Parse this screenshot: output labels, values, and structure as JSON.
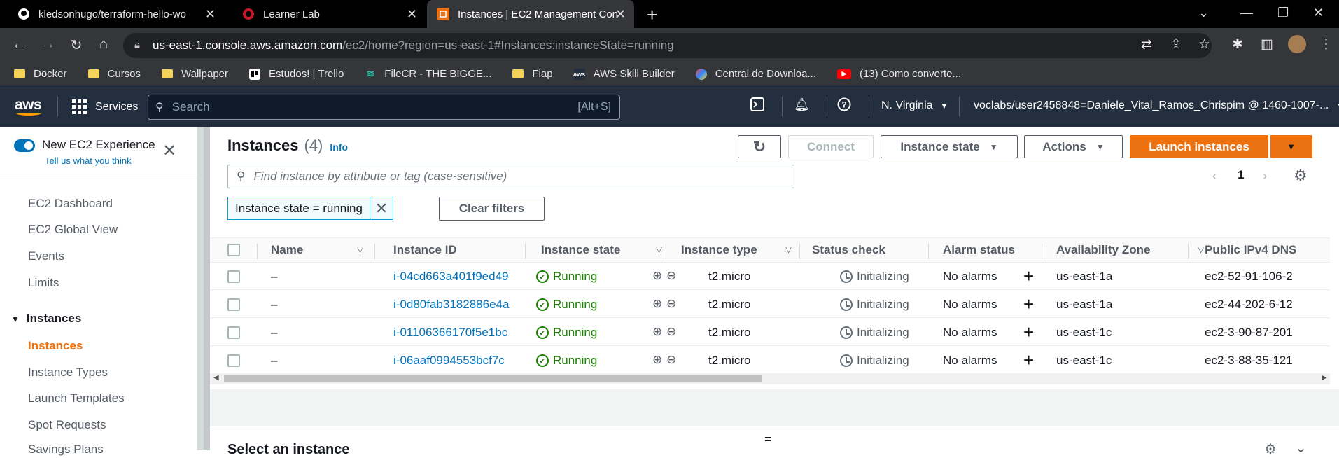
{
  "browser": {
    "tabs": [
      {
        "label": "kledsonhugo/terraform-hello-wo",
        "icon": "github-icon"
      },
      {
        "label": "Learner Lab",
        "icon": "learner-lab-icon"
      },
      {
        "label": "Instances | EC2 Management Con",
        "icon": "ec2-icon"
      }
    ],
    "url_host": "us-east-1.console.aws.amazon.com",
    "url_path": "/ec2/home?region=us-east-1#Instances:instanceState=running",
    "bookmarks": [
      {
        "label": "Docker",
        "icon": "folder-icon"
      },
      {
        "label": "Cursos",
        "icon": "folder-icon"
      },
      {
        "label": "Wallpaper",
        "icon": "folder-icon"
      },
      {
        "label": "Estudos! | Trello",
        "icon": "trello-icon"
      },
      {
        "label": "FileCR - THE BIGGE...",
        "icon": "filecr-icon"
      },
      {
        "label": "Fiap",
        "icon": "folder-icon"
      },
      {
        "label": "AWS Skill Builder",
        "icon": "aws-icon"
      },
      {
        "label": "Central de Downloa...",
        "icon": "central-icon"
      },
      {
        "label": "(13) Como converte...",
        "icon": "youtube-icon"
      }
    ]
  },
  "aws_nav": {
    "logo": "aws",
    "services": "Services",
    "search_placeholder": "Search",
    "search_shortcut": "[Alt+S]",
    "region": "N. Virginia",
    "account": "voclabs/user2458848=Daniele_Vital_Ramos_Chrispim @ 1460-1007-..."
  },
  "sidebar": {
    "new_experience": "New EC2 Experience",
    "tell_us": "Tell us what you think",
    "items_top": [
      "EC2 Dashboard",
      "EC2 Global View",
      "Events",
      "Limits"
    ],
    "section": "Instances",
    "items_section": [
      "Instances",
      "Instance Types",
      "Launch Templates",
      "Spot Requests",
      "Savings Plans"
    ],
    "active": "Instances"
  },
  "main": {
    "title": "Instances",
    "count": "(4)",
    "info": "Info",
    "connect": "Connect",
    "instance_state": "Instance state",
    "actions": "Actions",
    "launch": "Launch instances",
    "filter_placeholder": "Find instance by attribute or tag (case-sensitive)",
    "page": "1",
    "token": "Instance state = running",
    "clear_filters": "Clear filters",
    "columns": [
      "Name",
      "Instance ID",
      "Instance state",
      "Instance type",
      "Status check",
      "Alarm status",
      "Availability Zone",
      "Public IPv4 DNS"
    ],
    "rows": [
      {
        "name": "–",
        "id": "i-04cd663a401f9ed49",
        "state": "Running",
        "type": "t2.micro",
        "status": "Initializing",
        "alarm": "No alarms",
        "az": "us-east-1a",
        "dns": "ec2-52-91-106-2"
      },
      {
        "name": "–",
        "id": "i-0d80fab3182886e4a",
        "state": "Running",
        "type": "t2.micro",
        "status": "Initializing",
        "alarm": "No alarms",
        "az": "us-east-1a",
        "dns": "ec2-44-202-6-12"
      },
      {
        "name": "–",
        "id": "i-01106366170f5e1bc",
        "state": "Running",
        "type": "t2.micro",
        "status": "Initializing",
        "alarm": "No alarms",
        "az": "us-east-1c",
        "dns": "ec2-3-90-87-201"
      },
      {
        "name": "–",
        "id": "i-06aaf0994553bcf7c",
        "state": "Running",
        "type": "t2.micro",
        "status": "Initializing",
        "alarm": "No alarms",
        "az": "us-east-1c",
        "dns": "ec2-3-88-35-121"
      }
    ],
    "select_instance": "Select an instance"
  }
}
